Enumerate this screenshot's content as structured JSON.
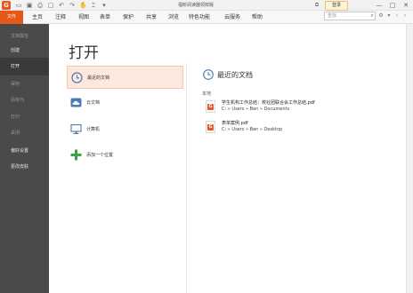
{
  "app": {
    "logo": "G",
    "title": "福昕阅读器领鲜版"
  },
  "titlebar": {
    "icons": [
      "open-folder-icon",
      "save-icon",
      "print-icon",
      "new-doc-icon",
      "undo-icon",
      "redo-icon",
      "hand-icon",
      "select-icon",
      "more-icon"
    ],
    "window_buttons": [
      "—",
      "□",
      "✕"
    ]
  },
  "menubar": {
    "file": "文件",
    "items": [
      "主页",
      "注释",
      "视图",
      "表单",
      "保护",
      "共享",
      "浏览",
      "特色功能",
      "云服务",
      "帮助"
    ],
    "login": "登录",
    "search_placeholder": "查找"
  },
  "sidebar": {
    "items": [
      {
        "label": "文档属性",
        "state": "dim"
      },
      {
        "label": "创建",
        "state": "light"
      },
      {
        "label": "打开",
        "state": "active"
      },
      {
        "label": "保存",
        "state": "dim"
      },
      {
        "label": "另存为",
        "state": "dim"
      },
      {
        "label": "打印",
        "state": "dim"
      },
      {
        "label": "关闭",
        "state": "dim"
      },
      {
        "label": "偏好设置",
        "state": "light"
      },
      {
        "label": "更改皮肤",
        "state": "light"
      }
    ]
  },
  "main": {
    "title": "打开",
    "sources": [
      {
        "label": "最近的文档",
        "icon": "clock-icon"
      },
      {
        "label": "云文档",
        "icon": "cloud-icon"
      },
      {
        "label": "计算机",
        "icon": "computer-icon"
      },
      {
        "label": "添加一个位置",
        "icon": "plus-icon"
      }
    ],
    "recent": {
      "title": "最近的文档",
      "section": "本地",
      "files": [
        {
          "name": "学生机构工作总结：校社团联合会工作总结.pdf",
          "path": "C: » Users » Ben » Documents"
        },
        {
          "name": "表单案例.pdf",
          "path": "C: » Users » Ben » Desktop"
        }
      ]
    }
  },
  "colors": {
    "accent": "#e8571a",
    "sidebar_bg": "#4a4a4a",
    "selected_bg": "#fde8de",
    "icon_blue": "#4a7bb0",
    "plus_green": "#3aa344"
  }
}
